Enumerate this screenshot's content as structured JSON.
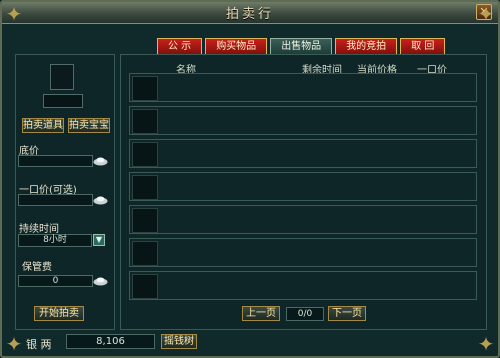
{
  "window": {
    "title": "拍卖行"
  },
  "tabs": [
    {
      "label": "公 示",
      "active": false
    },
    {
      "label": "购买物品",
      "active": false
    },
    {
      "label": "出售物品",
      "active": true
    },
    {
      "label": "我的竞拍",
      "active": false
    },
    {
      "label": "取 回",
      "active": false
    }
  ],
  "left_panel": {
    "buttons": {
      "auction_item": "拍卖道具",
      "auction_treasure": "拍卖宝宝",
      "start": "开始拍卖"
    },
    "labels": {
      "base_price": "底价",
      "buyout": "一口价(可选)",
      "duration": "持续时间",
      "fee": "保管费"
    },
    "duration_value": "8小时",
    "fee_value": "0"
  },
  "table": {
    "headers": [
      "名称",
      "剩余时间",
      "当前价格",
      "一口价"
    ],
    "rows": [
      {},
      {},
      {},
      {},
      {},
      {},
      {}
    ]
  },
  "pager": {
    "prev": "上一页",
    "next": "下一页",
    "info": "0/0"
  },
  "bottom": {
    "currency_label": "银 两",
    "currency_value": "8,106",
    "action": "摇钱树"
  },
  "colors": {
    "tab_red": "#c8201a",
    "gold_text": "#ffe7a0",
    "panel_bg": "#0e2628"
  }
}
